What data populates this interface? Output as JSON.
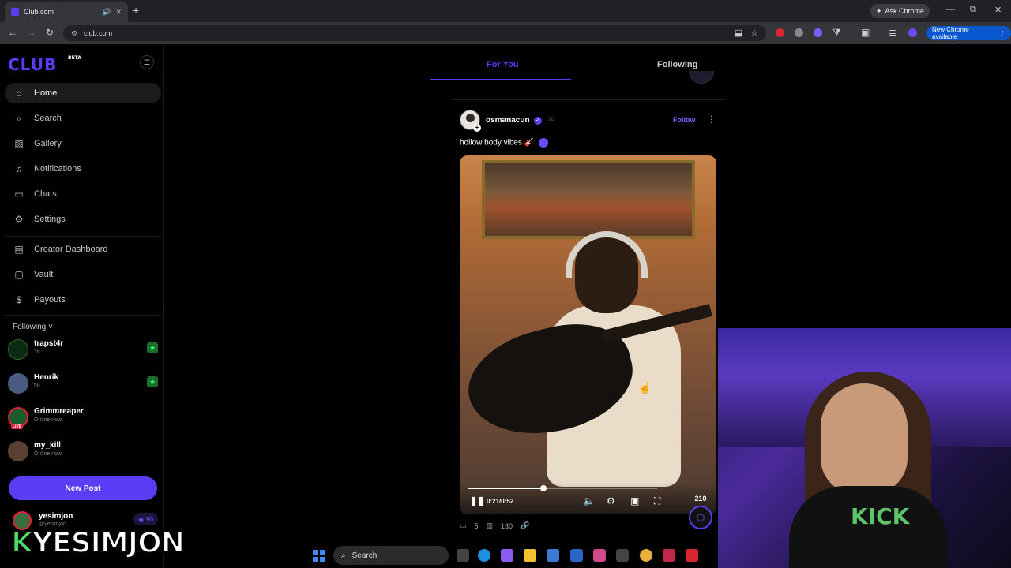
{
  "browser": {
    "tab_title": "Club.com",
    "new_tab_icon": "+",
    "ask_chrome": "Ask Chrome",
    "url": "club.com",
    "new_chrome": "New Chrome available",
    "window_minimize": "—",
    "window_restore": "⧉",
    "window_close": "✕"
  },
  "sidebar": {
    "logo": "CLUB",
    "logo_badge": "BETA",
    "nav": [
      {
        "label": "Home",
        "icon": "home-icon"
      },
      {
        "label": "Search",
        "icon": "search-icon"
      },
      {
        "label": "Gallery",
        "icon": "gallery-icon"
      },
      {
        "label": "Notifications",
        "icon": "bell-icon"
      },
      {
        "label": "Chats",
        "icon": "chat-icon"
      },
      {
        "label": "Settings",
        "icon": "gear-icon"
      },
      {
        "label": "Creator Dashboard",
        "icon": "dashboard-icon"
      },
      {
        "label": "Vault",
        "icon": "vault-icon"
      },
      {
        "label": "Payouts",
        "icon": "dollar-icon"
      }
    ],
    "following_label": "Following",
    "following": [
      {
        "name": "trapst4r",
        "sub": "1h"
      },
      {
        "name": "Henrik",
        "sub": "5h"
      },
      {
        "name": "Grimmreaper",
        "sub": "Online now"
      },
      {
        "name": "my_kill",
        "sub": "Online now"
      }
    ],
    "live_badge": "LIVE",
    "new_post": "New Post",
    "me": {
      "name": "yesimjon",
      "handle": "@yesimjon",
      "points": "90"
    },
    "overlay_k": "K",
    "overlay_name": "YESIMJON"
  },
  "feed": {
    "tabs": [
      "For You",
      "Following"
    ],
    "post": {
      "username": "osmanacun",
      "age": "2d",
      "follow": "Follow",
      "caption": "hollow body vibes 🎸",
      "video_time": "0:21/0:52",
      "progress": 0.4,
      "likes_bubble": "210",
      "comments": "5",
      "views": "130"
    }
  },
  "webcam": {
    "shirt_text": "KICK"
  },
  "taskbar": {
    "search": "Search"
  },
  "colors": {
    "accent": "#5b3df5",
    "live": "#e91e3c",
    "green": "#3dff6b"
  }
}
